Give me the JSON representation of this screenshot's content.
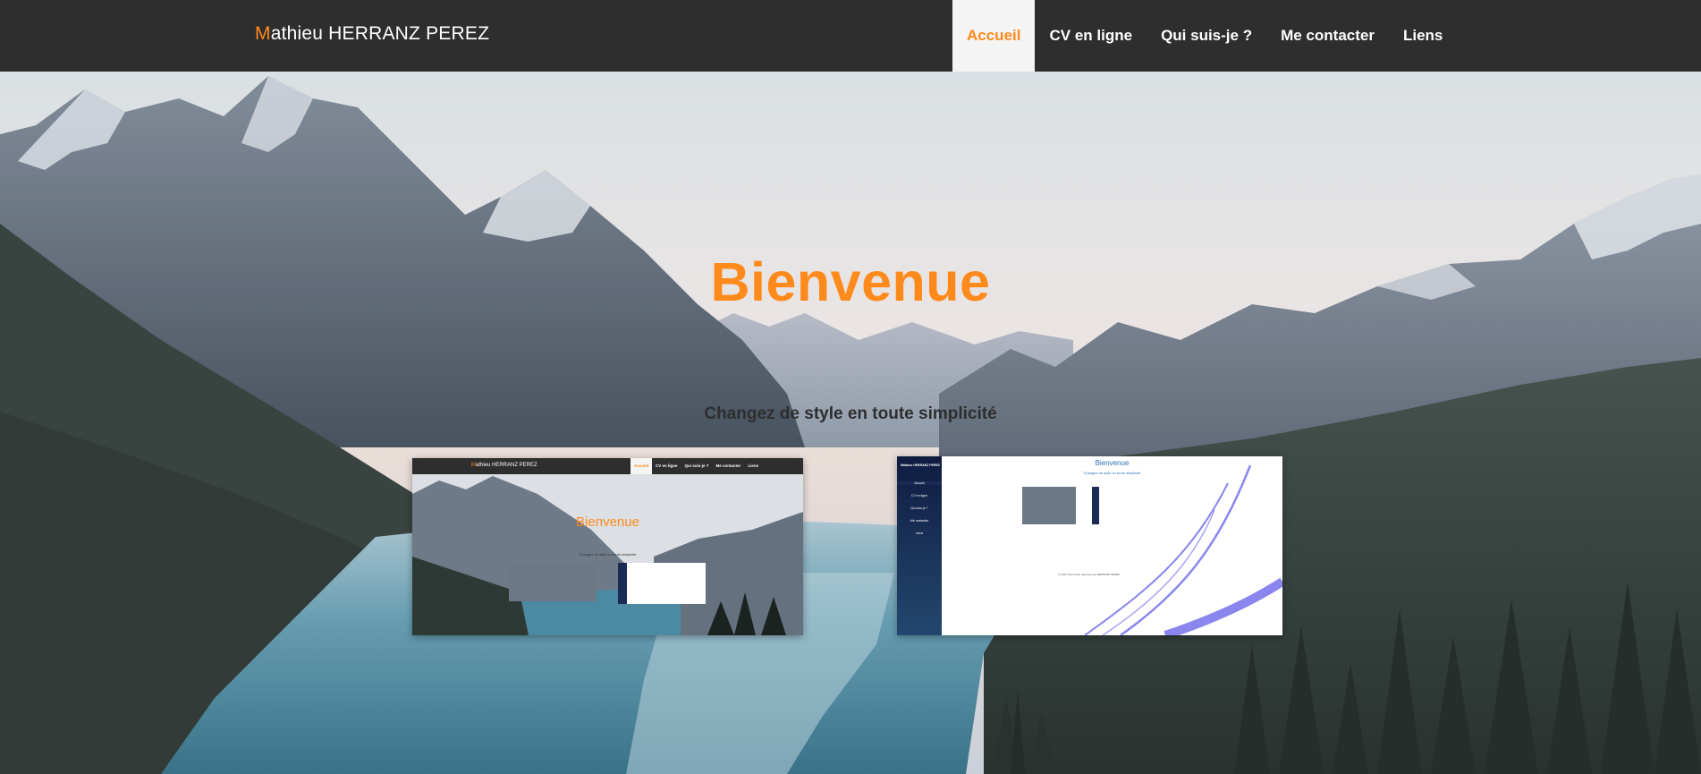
{
  "brand": {
    "first_letter": "M",
    "rest": "athieu HERRANZ PEREZ"
  },
  "nav": {
    "items": [
      {
        "label": "Accueil",
        "active": true
      },
      {
        "label": "CV en ligne",
        "active": false
      },
      {
        "label": "Qui suis-je ?",
        "active": false
      },
      {
        "label": "Me contacter",
        "active": false
      },
      {
        "label": "Liens",
        "active": false
      }
    ]
  },
  "hero": {
    "title": "Bienvenue",
    "subtitle": "Changez de style en toute simplicité"
  },
  "thumbnails": {
    "theme1": {
      "brand_first": "M",
      "brand_rest": "athieu HERRANZ PEREZ",
      "nav": [
        "Accueil",
        "CV en ligne",
        "Qui suis-je ?",
        "Me contacter",
        "Liens"
      ],
      "title": "Bienvenue",
      "subtitle": "Changez de style en toute simplicité"
    },
    "theme2": {
      "brand": "Mathieu HERRANZ PEREZ",
      "nav": [
        "Accueil",
        "CV en ligne",
        "Qui suis-je ?",
        "Me contacter",
        "Liens"
      ],
      "title": "Bienvenue",
      "subtitle": "Changez de style en toute simplicité",
      "footer": "© 2015 Tous droits réservés par HERRANZ PEREZ"
    }
  },
  "colors": {
    "accent": "#ff8a1c",
    "navbar": "#2e2e2e",
    "active_tab_bg": "#f4f4f4",
    "subtitle": "#2e2e2e"
  }
}
